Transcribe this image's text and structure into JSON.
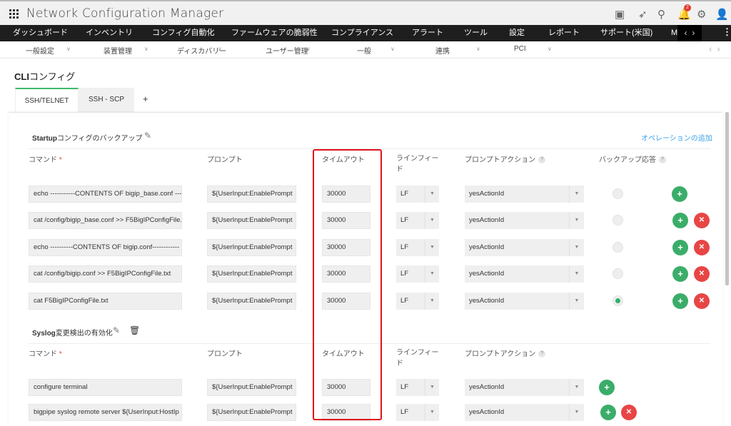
{
  "header": {
    "title": "Network Configuration Manager",
    "notification_count": "2",
    "icons": [
      "presentation-icon",
      "rocket-icon",
      "search-icon",
      "bell-icon",
      "gear-icon",
      "user-icon"
    ]
  },
  "main_nav": [
    "ダッシュボード",
    "インベントリ",
    "コンフィグ自動化",
    "ファームウェアの脆弱性",
    "コンプライアンス",
    "アラート",
    "ツール",
    "設定",
    "レポート",
    "サポート(米国)",
    "M"
  ],
  "sub_nav": [
    "一般設定",
    "装置管理",
    "ディスカバリー",
    "ユーザー管理",
    "一般",
    "連携",
    "PCI"
  ],
  "page": {
    "title_bold": "CLI",
    "title_rest": "コンフィグ"
  },
  "tabs": [
    "SSH/TELNET",
    "SSH - SCP",
    "+"
  ],
  "add_operation": "オペレーションの追加",
  "columns": {
    "command": "コマンド",
    "required": "*",
    "prompt": "プロンプト",
    "timeout": "タイムアウト",
    "linefeed": "ラインフィード",
    "prompt_action": "プロンプトアクション",
    "backup_response": "バックアップ応答",
    "help": "?"
  },
  "sections": [
    {
      "title_bold": "Startup",
      "title_rest": "コンフィグのバックアップ",
      "rows": [
        {
          "command": "echo -----------CONTENTS OF bigip_base.conf ----",
          "prompt": "${UserInput:EnablePrompt",
          "timeout": "30000",
          "linefeed": "LF",
          "action": "yesActionId",
          "backup": false
        },
        {
          "command": "cat /config/bigip_base.conf >> F5BigIPConfigFile.",
          "prompt": "${UserInput:EnablePrompt",
          "timeout": "30000",
          "linefeed": "LF",
          "action": "yesActionId",
          "backup": false
        },
        {
          "command": "echo ----------CONTENTS OF bigip.conf------------",
          "prompt": "${UserInput:EnablePrompt",
          "timeout": "30000",
          "linefeed": "LF",
          "action": "yesActionId",
          "backup": false
        },
        {
          "command": "cat /config/bigip.conf >> F5BigIPConfigFile.txt",
          "prompt": "${UserInput:EnablePrompt",
          "timeout": "30000",
          "linefeed": "LF",
          "action": "yesActionId",
          "backup": false
        },
        {
          "command": "cat F5BigIPConfigFile.txt",
          "prompt": "${UserInput:EnablePrompt",
          "timeout": "30000",
          "linefeed": "LF",
          "action": "yesActionId",
          "backup": true
        }
      ]
    },
    {
      "title_bold": "Syslog",
      "title_rest": "変更検出の有効化",
      "rows": [
        {
          "command": "configure terminal",
          "prompt": "${UserInput:EnablePrompt",
          "timeout": "30000",
          "linefeed": "LF",
          "action": "yesActionId"
        },
        {
          "command": "bigpipe syslog remote server ${UserInput:HostIp",
          "prompt": "${UserInput:EnablePrompt",
          "timeout": "30000",
          "linefeed": "LF",
          "action": "yesActionId"
        }
      ]
    }
  ],
  "colors": {
    "accent": "#3dbb6b",
    "add": "#3aad69",
    "delete": "#e84545",
    "link": "#3aa0e8",
    "highlight": "#e0141c"
  }
}
